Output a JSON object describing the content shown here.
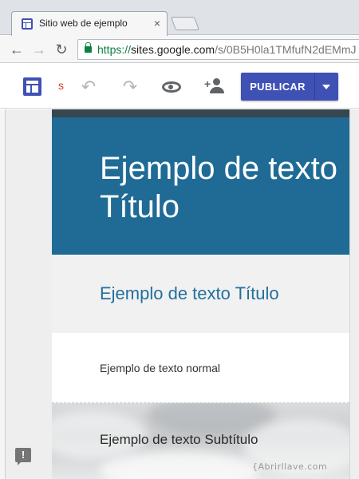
{
  "browser": {
    "tab": {
      "title": "Sitio web de ejemplo",
      "close_glyph": "×",
      "favicon": "google-sites-icon"
    },
    "nav": {
      "back_glyph": "←",
      "forward_glyph": "→",
      "reload_glyph": "↻"
    },
    "url": {
      "scheme": "https://",
      "host": "sites.google.com",
      "path": "/s/0B5H0la1TMfufN2dEMmJ"
    }
  },
  "toolbar": {
    "site_name_truncated": "s",
    "undo_glyph": "↶",
    "redo_glyph": "↷",
    "publish_label": "PUBLICAR",
    "accent_color": "#3f51b5"
  },
  "page": {
    "header_title": "Ejemplo de texto Título",
    "section_title": "Ejemplo de texto Título",
    "body_text": "Ejemplo de texto normal",
    "subtitle": "Ejemplo de texto Subtítulo",
    "header_color": "#1f6b96"
  },
  "feedback": {
    "glyph": "!"
  },
  "watermark": "{Abrirllave.com"
}
